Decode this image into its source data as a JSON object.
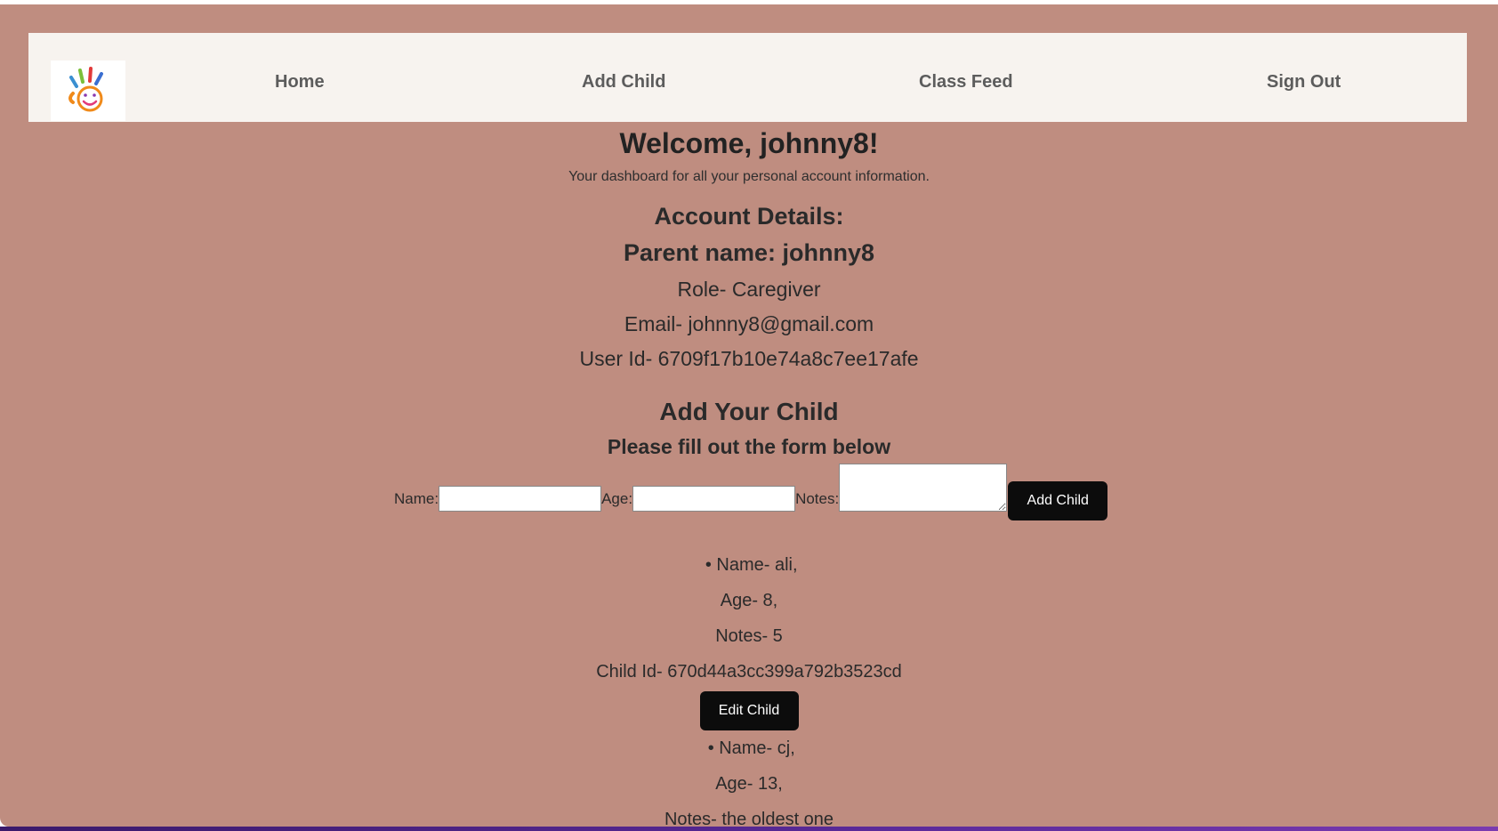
{
  "nav": {
    "logo_icon": "hand-smiley-logo-icon",
    "links": [
      "Home",
      "Add Child",
      "Class Feed",
      "Sign Out"
    ]
  },
  "header": {
    "welcome": "Welcome, johnny8!",
    "subtitle": "Your dashboard for all your personal account information."
  },
  "account": {
    "heading": "Account Details:",
    "parent_name": "Parent name: johnny8",
    "role": "Role- Caregiver",
    "email": "Email- johnny8@gmail.com",
    "user_id": "User Id- 6709f17b10e74a8c7ee17afe"
  },
  "form": {
    "heading": "Add Your Child",
    "subheading": "Please fill out the form below",
    "name_label": "Name:",
    "age_label": "Age:",
    "notes_label": "Notes:",
    "name_value": "",
    "age_value": "",
    "notes_value": "",
    "submit_label": "Add Child"
  },
  "children": [
    {
      "name": "Name- ali,",
      "age": "Age- 8,",
      "notes": "Notes- 5",
      "id": "Child Id- 670d44a3cc399a792b3523cd",
      "edit_label": "Edit Child"
    },
    {
      "name": "Name- cj,",
      "age": "Age- 13,",
      "notes": "Notes- the oldest one"
    }
  ],
  "colors": {
    "background": "#bf8d80",
    "navbar": "#f7f3ef",
    "button": "#0c0c0c"
  }
}
